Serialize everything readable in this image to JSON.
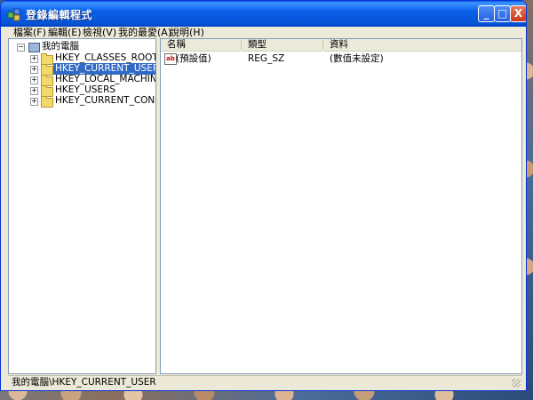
{
  "window": {
    "title": "登錄編輯程式",
    "controls": {
      "minimize": "_",
      "maximize": "□",
      "close": "X"
    }
  },
  "menu": [
    {
      "label": "檔案(F)"
    },
    {
      "label": "編輯(E)"
    },
    {
      "label": "檢視(V)"
    },
    {
      "label": "我的最愛(A)"
    },
    {
      "label": "說明(H)"
    }
  ],
  "tree": {
    "root": {
      "label": "我的電腦",
      "expander": "−"
    },
    "children": [
      {
        "label": "HKEY_CLASSES_ROOT",
        "expander": "+",
        "selected": false
      },
      {
        "label": "HKEY_CURRENT_USER",
        "expander": "+",
        "selected": true
      },
      {
        "label": "HKEY_LOCAL_MACHINE",
        "expander": "+",
        "selected": false
      },
      {
        "label": "HKEY_USERS",
        "expander": "+",
        "selected": false
      },
      {
        "label": "HKEY_CURRENT_CONFIG",
        "expander": "+",
        "selected": false
      }
    ]
  },
  "list": {
    "columns": [
      "名稱",
      "類型",
      "資料"
    ],
    "rows": [
      {
        "icon": "ab",
        "name": "(預設值)",
        "type": "REG_SZ",
        "data": "(數值未設定)"
      }
    ]
  },
  "status": {
    "path": "我的電腦\\HKEY_CURRENT_USER"
  },
  "colors": {
    "titlebar": "#0a5fe8",
    "selection": "#316ac5",
    "chrome": "#ece9d8"
  }
}
